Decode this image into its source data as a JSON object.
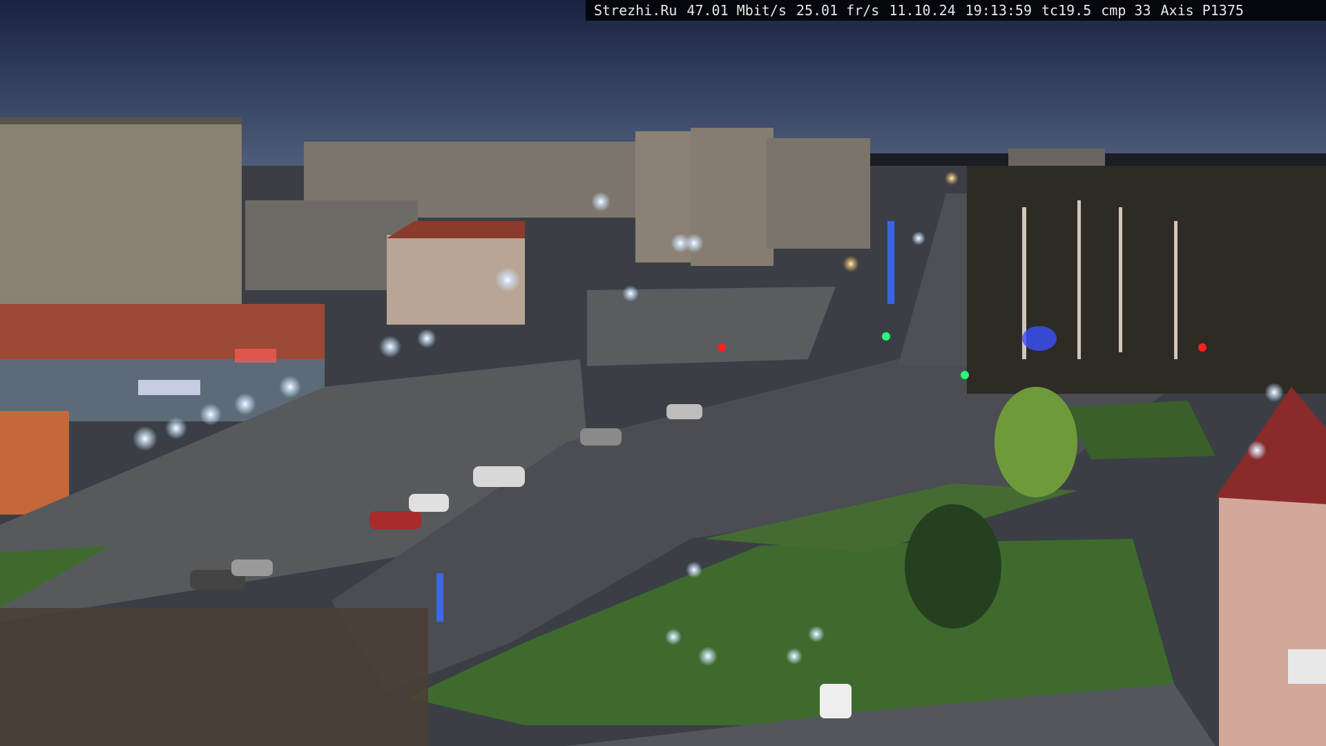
{
  "camera_overlay": {
    "site": "Strezhi.Ru",
    "bitrate": "47.01 Mbit/s",
    "framerate": "25.01 fr/s",
    "date": "11.10.24",
    "time": "19:13:59",
    "tc": "tc19.5",
    "cmp": "cmp 33",
    "camera_model": "Axis P1375"
  },
  "scene": {
    "description_type": "night city webcam view",
    "colors": {
      "sky_top": "#1c2645",
      "sky_horizon": "#4a5a7a",
      "road": "#4b4d52",
      "grass": "#3f6a2e",
      "building_beige": "#8c8378",
      "building_red": "#8a3b2c",
      "street_light": "#e6f3ff"
    }
  }
}
